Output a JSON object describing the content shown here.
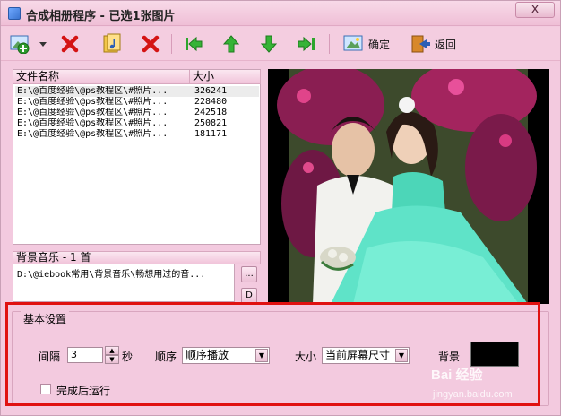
{
  "window": {
    "title": "合成相册程序 - 已选1张图片",
    "close_label": "x"
  },
  "toolbar": {
    "confirm_label": "确定",
    "back_label": "返回"
  },
  "file_list": {
    "columns": [
      "文件名称",
      "大小"
    ],
    "rows": [
      {
        "name": "E:\\@百度经验\\@ps教程区\\#照片...",
        "size": "326241"
      },
      {
        "name": "E:\\@百度经验\\@ps教程区\\#照片...",
        "size": "228480"
      },
      {
        "name": "E:\\@百度经验\\@ps教程区\\#照片...",
        "size": "242518"
      },
      {
        "name": "E:\\@百度经验\\@ps教程区\\#照片...",
        "size": "250821"
      },
      {
        "name": "E:\\@百度经验\\@ps教程区\\#照片...",
        "size": "181171"
      }
    ]
  },
  "music": {
    "header": "背景音乐 - 1 首",
    "item": "D:\\@iebook常用\\背景音乐\\畅想用过的音...",
    "browse_label": "...",
    "delete_label": "D"
  },
  "settings": {
    "legend": "基本设置",
    "interval_label": "间隔",
    "interval_value": "3",
    "interval_unit": "秒",
    "order_label": "顺序",
    "order_value": "顺序播放",
    "size_label": "大小",
    "size_value": "当前屏幕尺寸",
    "background_label": "背景",
    "background_color": "#000000",
    "run_after_label": "完成后运行",
    "run_after_checked": false
  },
  "watermark": {
    "brand": "Bai 经验",
    "url": "jingyan.baidu.com"
  },
  "colors": {
    "window_bg": "#f3cadf",
    "highlight_outline": "#e01111"
  }
}
